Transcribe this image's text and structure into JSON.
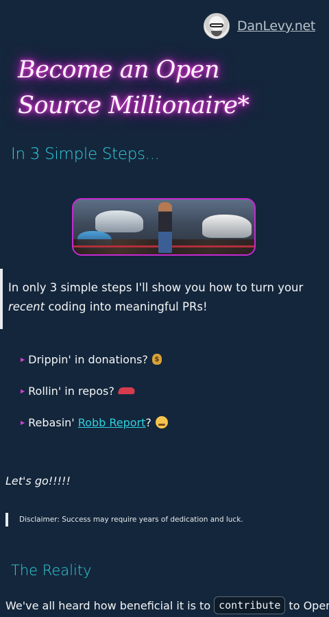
{
  "header": {
    "site_link": "DanLevy.net",
    "avatar": "author-avatar"
  },
  "hero": {
    "title": "Become an Open Source Millionaire*",
    "subtitle": "In 3 Simple Steps...",
    "image": "millionaire-car-crowd-illustration"
  },
  "intro": {
    "before": "In only 3 simple steps I'll show you how to turn your ",
    "emphasis": "recent",
    "after": " coding into meaningful PRs!"
  },
  "bullets": [
    {
      "text": "Drippin' in donations?",
      "emoji": "money-bag"
    },
    {
      "text": "Rollin' in repos?",
      "emoji": "race-car"
    },
    {
      "before": "Rebasin' ",
      "link": "Robb Report",
      "after": "?",
      "emoji": "face-with-cowboy-hat"
    }
  ],
  "lets_go": "Let's go!!!!!",
  "disclaimer": "Disclaimer: Success may require years of dedication and luck.",
  "section": {
    "heading": "The Reality",
    "text_before": "We've all heard how beneficial it is to",
    "code": "contribute",
    "text_after": "to Open"
  },
  "colors": {
    "background": "#14263b",
    "accent_cyan": "#2fd0e0",
    "accent_magenta": "#d53cd6",
    "neon_glow": "#ff4fe8"
  }
}
